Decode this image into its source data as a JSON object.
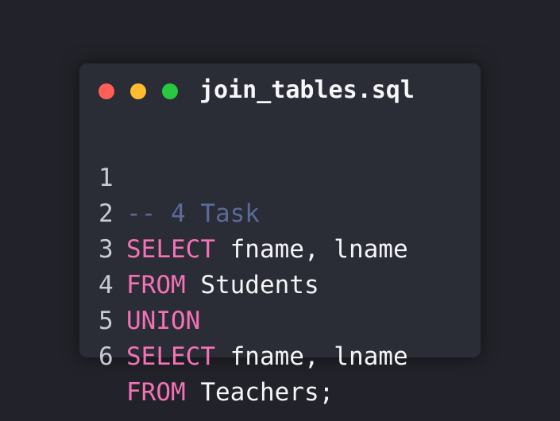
{
  "window": {
    "file_name": "join_tables.sql",
    "controls": [
      {
        "name": "close",
        "color": "#ff5f57"
      },
      {
        "name": "minimize",
        "color": "#febc2e"
      },
      {
        "name": "maximize",
        "color": "#28c840"
      }
    ]
  },
  "code": {
    "lines": [
      {
        "number": "1",
        "tokens": [
          {
            "type": "comment",
            "text": "-- 4 Task"
          }
        ]
      },
      {
        "number": "2",
        "tokens": [
          {
            "type": "keyword",
            "text": "SELECT"
          },
          {
            "type": "text",
            "text": " fname, lname"
          }
        ]
      },
      {
        "number": "3",
        "tokens": [
          {
            "type": "keyword",
            "text": "FROM"
          },
          {
            "type": "text",
            "text": " Students"
          }
        ]
      },
      {
        "number": "4",
        "tokens": [
          {
            "type": "keyword",
            "text": "UNION"
          }
        ]
      },
      {
        "number": "5",
        "tokens": [
          {
            "type": "keyword",
            "text": "SELECT"
          },
          {
            "type": "text",
            "text": " fname, lname"
          }
        ]
      },
      {
        "number": "6",
        "tokens": [
          {
            "type": "keyword",
            "text": "FROM"
          },
          {
            "type": "text",
            "text": " Teachers;"
          }
        ]
      }
    ]
  },
  "colors": {
    "background": "#22232a",
    "window": "#2a2c36",
    "keyword": "#f472b6",
    "comment": "#5b6a99",
    "text": "#f5f5f7",
    "line_number": "#c9cad2"
  }
}
